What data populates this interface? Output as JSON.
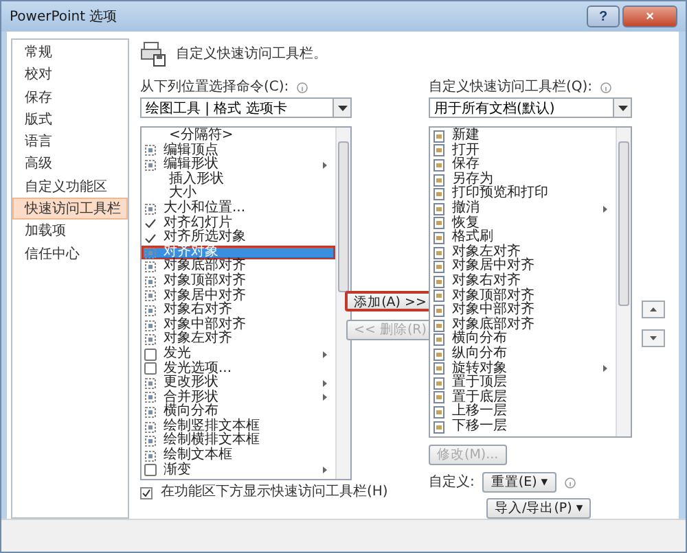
{
  "window": {
    "title": "PowerPoint 选项",
    "buttons": [
      "?",
      "×"
    ]
  },
  "sidebar": {
    "items": [
      {
        "label": "常规",
        "selected": false
      },
      {
        "label": "校对",
        "selected": false
      },
      {
        "label": "保存",
        "selected": false
      },
      {
        "label": "版式",
        "selected": false
      },
      {
        "label": "语言",
        "selected": false
      },
      {
        "label": "高级",
        "selected": false
      },
      {
        "label": "自定义功能区",
        "selected": false
      },
      {
        "label": "快速访问工具栏",
        "selected": true
      },
      {
        "label": "加载项",
        "selected": false
      },
      {
        "label": "信任中心",
        "selected": false
      }
    ]
  },
  "header": "自定义快速访问工具栏。",
  "source": {
    "label": "从下列位置选择命令(C):",
    "dropdown": "绘图工具 | 格式 选项卡",
    "items": [
      {
        "label": "<分隔符>",
        "kind": "separator",
        "submenu": false,
        "selected": false
      },
      {
        "label": "编辑顶点",
        "kind": "command",
        "submenu": false,
        "selected": false
      },
      {
        "label": "编辑形状",
        "kind": "command",
        "submenu": true,
        "selected": false
      },
      {
        "label": "插入形状",
        "kind": "plain",
        "submenu": false,
        "selected": false
      },
      {
        "label": "大小",
        "kind": "plain",
        "submenu": false,
        "selected": false
      },
      {
        "label": "大小和位置...",
        "kind": "command",
        "submenu": false,
        "selected": false
      },
      {
        "label": "对齐幻灯片",
        "kind": "check",
        "submenu": false,
        "selected": false
      },
      {
        "label": "对齐所选对象",
        "kind": "check",
        "submenu": false,
        "selected": false
      },
      {
        "label": "对齐对象",
        "kind": "command",
        "submenu": false,
        "selected": true
      },
      {
        "label": "对象底部对齐",
        "kind": "command",
        "submenu": false,
        "selected": false
      },
      {
        "label": "对象顶部对齐",
        "kind": "command",
        "submenu": false,
        "selected": false
      },
      {
        "label": "对象居中对齐",
        "kind": "command",
        "submenu": false,
        "selected": false
      },
      {
        "label": "对象右对齐",
        "kind": "command",
        "submenu": false,
        "selected": false
      },
      {
        "label": "对象中部对齐",
        "kind": "command",
        "submenu": false,
        "selected": false
      },
      {
        "label": "对象左对齐",
        "kind": "command",
        "submenu": false,
        "selected": false
      },
      {
        "label": "发光",
        "kind": "box",
        "submenu": true,
        "selected": false
      },
      {
        "label": "发光选项...",
        "kind": "box",
        "submenu": false,
        "selected": false
      },
      {
        "label": "更改形状",
        "kind": "command",
        "submenu": true,
        "selected": false
      },
      {
        "label": "合并形状",
        "kind": "command",
        "submenu": true,
        "selected": false
      },
      {
        "label": "横向分布",
        "kind": "command",
        "submenu": false,
        "selected": false
      },
      {
        "label": "绘制竖排文本框",
        "kind": "command",
        "submenu": false,
        "selected": false
      },
      {
        "label": "绘制横排文本框",
        "kind": "command",
        "submenu": false,
        "selected": false
      },
      {
        "label": "绘制文本框",
        "kind": "command",
        "submenu": false,
        "selected": false
      },
      {
        "label": "渐变",
        "kind": "box",
        "submenu": true,
        "selected": false
      }
    ]
  },
  "add_button": {
    "label": "添加(A) >>",
    "highlighted": true
  },
  "remove_button": {
    "label": "<< 删除(R)",
    "disabled": true
  },
  "target": {
    "label": "自定义快速访问工具栏(Q):",
    "dropdown": "用于所有文档(默认)",
    "items": [
      {
        "label": "新建",
        "submenu": false
      },
      {
        "label": "打开",
        "submenu": false
      },
      {
        "label": "保存",
        "submenu": false
      },
      {
        "label": "另存为",
        "submenu": false
      },
      {
        "label": "打印预览和打印",
        "submenu": false
      },
      {
        "label": "撤消",
        "submenu": true
      },
      {
        "label": "恢复",
        "submenu": false
      },
      {
        "label": "格式刷",
        "submenu": false
      },
      {
        "label": "对象左对齐",
        "submenu": false
      },
      {
        "label": "对象居中对齐",
        "submenu": false
      },
      {
        "label": "对象右对齐",
        "submenu": false
      },
      {
        "label": "对象顶部对齐",
        "submenu": false
      },
      {
        "label": "对象中部对齐",
        "submenu": false
      },
      {
        "label": "对象底部对齐",
        "submenu": false
      },
      {
        "label": "横向分布",
        "submenu": false
      },
      {
        "label": "纵向分布",
        "submenu": false
      },
      {
        "label": "旋转对象",
        "submenu": true
      },
      {
        "label": "置于顶层",
        "submenu": false
      },
      {
        "label": "置于底层",
        "submenu": false
      },
      {
        "label": "上移一层",
        "submenu": false
      },
      {
        "label": "下移一层",
        "submenu": false
      }
    ]
  },
  "modify_button": {
    "label": "修改(M)...",
    "disabled": true
  },
  "customize": {
    "label": "自定义:",
    "reset": "重置(E) ▾",
    "import_export": "导入/导出(P) ▾"
  },
  "show_below": {
    "label": "在功能区下方显示快速访问工具栏(H)",
    "checked": true
  }
}
